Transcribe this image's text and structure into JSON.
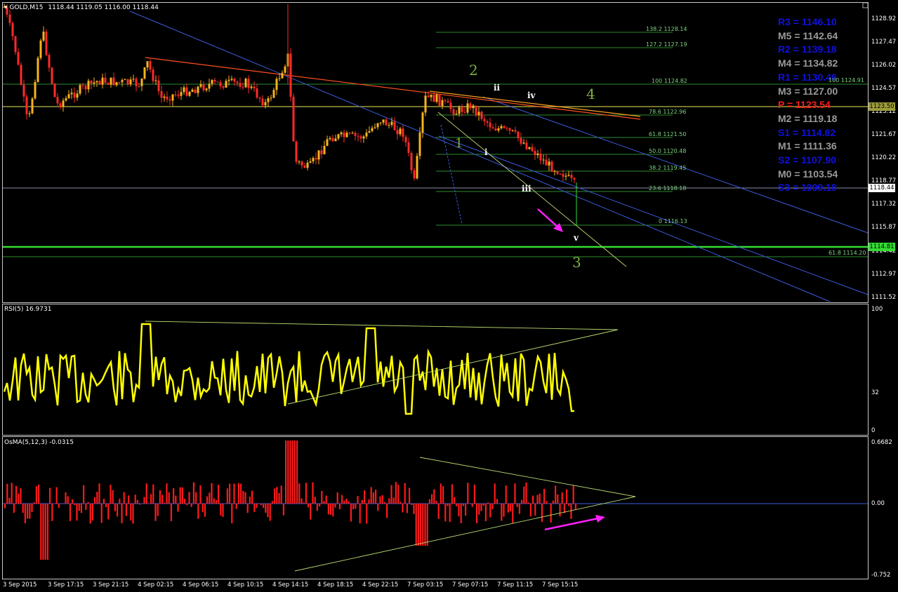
{
  "main": {
    "symbol_label": "GOLD,M15",
    "ohlc": "1118.44 1119.05 1116.00 1118.44",
    "yaxis": [
      "1128.92",
      "1127.47",
      "1126.02",
      "1124.57",
      "1123.12",
      "1121.67",
      "1120.22",
      "1118.77",
      "1117.32",
      "1115.87",
      "1114.42",
      "1112.97",
      "1111.52"
    ],
    "current_price": "1118.44",
    "line_price_1": "1123.50",
    "line_price_2": "1114.81",
    "pivots": [
      {
        "label": "R3 = 1146.10",
        "color": "#1010e0"
      },
      {
        "label": "M5 = 1142.64",
        "color": "#9a9a9a"
      },
      {
        "label": "R2 = 1139.18",
        "color": "#1010e0"
      },
      {
        "label": "M4 = 1134.82",
        "color": "#9a9a9a"
      },
      {
        "label": "R1 = 1130.46",
        "color": "#1010e0"
      },
      {
        "label": "M3 = 1127.00",
        "color": "#9a9a9a"
      },
      {
        "label": "P = 1123.54",
        "color": "#ff1a1a"
      },
      {
        "label": "M2 = 1119.18",
        "color": "#9a9a9a"
      },
      {
        "label": "S1 = 1114.82",
        "color": "#1010e0"
      },
      {
        "label": "M1 = 1111.36",
        "color": "#9a9a9a"
      },
      {
        "label": "S2 = 1107.90",
        "color": "#1010e0"
      },
      {
        "label": "M0 = 1103.54",
        "color": "#9a9a9a"
      },
      {
        "label": "S3 = 1099.18",
        "color": "#1010e0"
      }
    ],
    "fibs": [
      {
        "label": "138.2 1128.14"
      },
      {
        "label": "127.2 1127.19"
      },
      {
        "label": "100 1124.82"
      },
      {
        "label": "78.6 1122.96"
      },
      {
        "label": "61.8 1121.50"
      },
      {
        "label": "50.0 1120.48"
      },
      {
        "label": "38.2 1119.45"
      },
      {
        "label": "23.6 1118.18"
      },
      {
        "label": "0 1116.13"
      }
    ],
    "fib_extra_1": "61.8 1114.20",
    "fib_extra_2": "100 1124.91",
    "waves": [
      {
        "label": "2",
        "color": "#7fb040"
      },
      {
        "label": "1",
        "color": "#7fb040"
      },
      {
        "label": "4",
        "color": "#7fb040"
      },
      {
        "label": "3",
        "color": "#7fb040"
      },
      {
        "label": "ii",
        "color": "#ffffff"
      },
      {
        "label": "iv",
        "color": "#ffffff"
      },
      {
        "label": "i",
        "color": "#ffffff"
      },
      {
        "label": "iii",
        "color": "#ffffff"
      },
      {
        "label": "v",
        "color": "#ffffff"
      }
    ]
  },
  "rsi": {
    "label": "RSI(5) 16.9731",
    "yaxis": [
      "100",
      "32",
      "0"
    ]
  },
  "osma": {
    "label": "OsMA(5,12,3) -0.0315",
    "yaxis": [
      "0.6682",
      "0.00",
      "-0.752"
    ]
  },
  "xaxis": [
    "3 Sep 2015",
    "3 Sep 17:15",
    "3 Sep 21:15",
    "4 Sep 02:15",
    "4 Sep 06:15",
    "4 Sep 10:15",
    "4 Sep 14:15",
    "4 Sep 18:15",
    "4 Sep 22:15",
    "7 Sep 03:15",
    "7 Sep 07:15",
    "7 Sep 11:15",
    "7 Sep 15:15"
  ],
  "colors": {
    "bull": "#f7b41c",
    "bear": "#ff2a2a",
    "rsi": "#ffff00",
    "trend": "#3b5bdb",
    "fib": "#2e8b2e",
    "arrow": "#ff20ff"
  }
}
